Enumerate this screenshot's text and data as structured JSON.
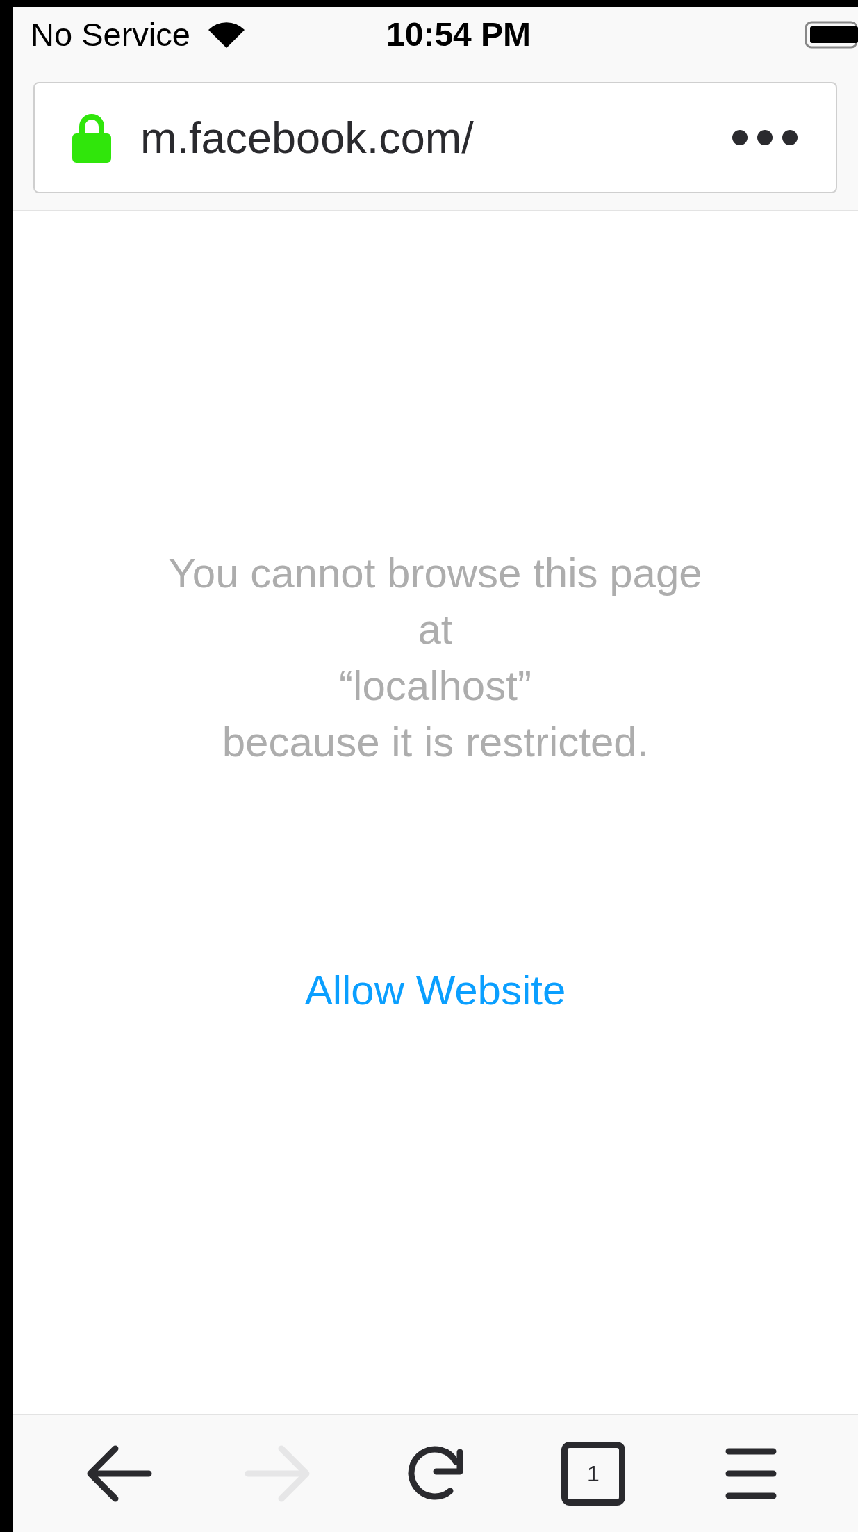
{
  "status_bar": {
    "carrier": "No Service",
    "time": "10:54 PM"
  },
  "address_bar": {
    "url": "m.facebook.com/",
    "secure": true
  },
  "message": {
    "lines": [
      "You cannot browse this page",
      "at",
      "“localhost”",
      "because it is restricted."
    ],
    "action": "Allow Website"
  },
  "toolbar": [
    {
      "kind": "back",
      "disabled": false
    },
    {
      "kind": "forward",
      "disabled": true
    },
    {
      "kind": "reload",
      "disabled": false
    },
    {
      "kind": "tabs",
      "count": "1",
      "disabled": false
    },
    {
      "kind": "menu",
      "disabled": false
    }
  ]
}
